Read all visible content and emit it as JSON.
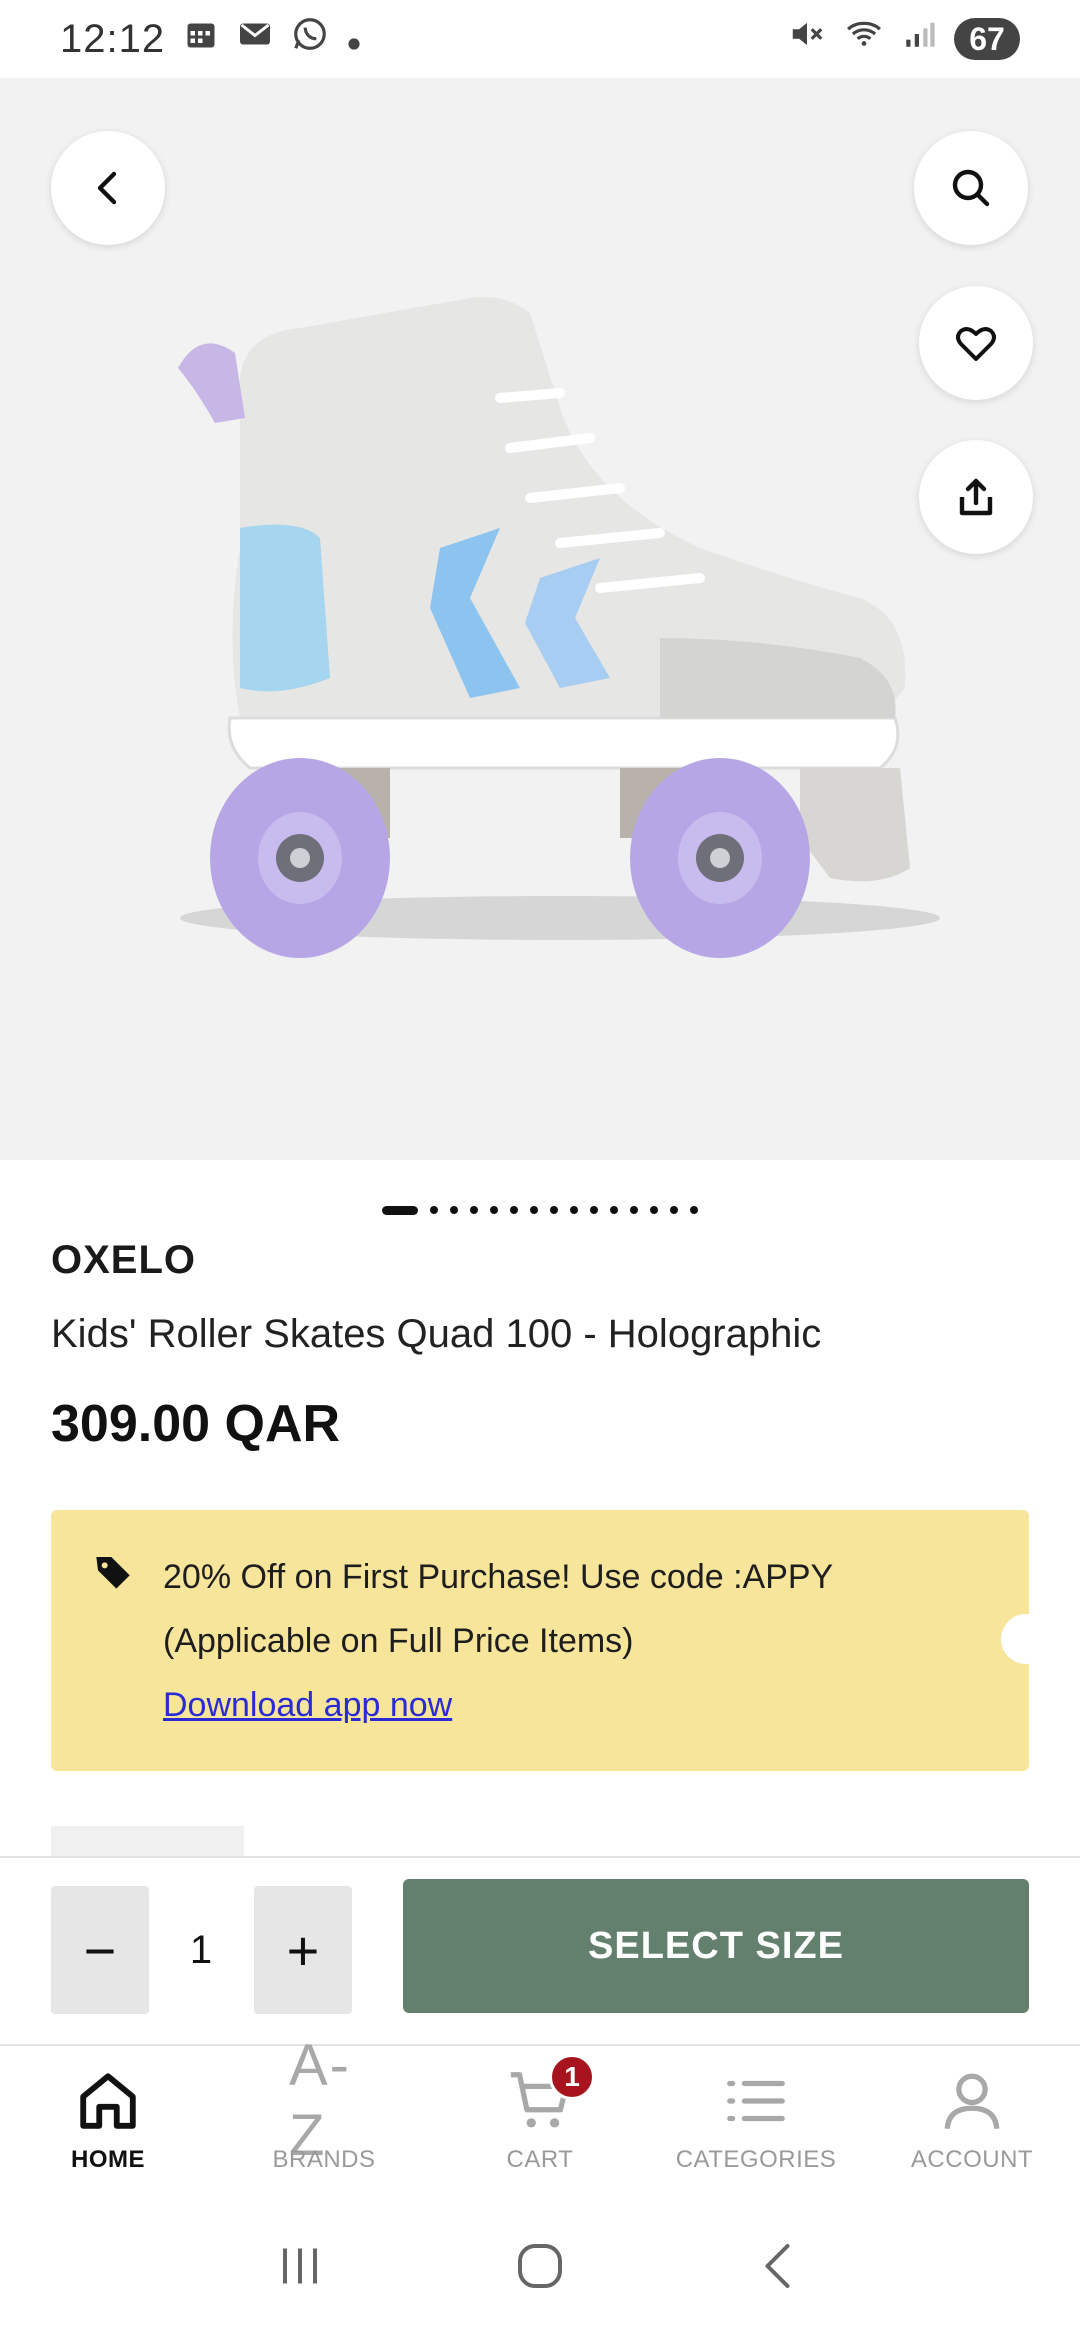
{
  "status_bar": {
    "time": "12:12",
    "battery": "67",
    "left_icons": [
      "calendar-icon",
      "mail-icon",
      "whatsapp-icon",
      "dot-icon"
    ],
    "right_icons": [
      "mute-icon",
      "wifi-icon",
      "signal-icon"
    ]
  },
  "product": {
    "brand": "OXELO",
    "title": "Kids' Roller Skates Quad 100 - Holographic",
    "price": "309.00 QAR",
    "image_count": 15,
    "active_image": 0
  },
  "promo": {
    "line1": "20% Off on First Purchase! Use code :APPY",
    "line2": "(Applicable on Full Price Items)",
    "link": "Download app now",
    "bg_color": "#f6e59b"
  },
  "purchase": {
    "quantity": "1",
    "minus": "−",
    "plus": "+",
    "select_size": "SELECT SIZE",
    "button_color": "#63806e"
  },
  "nav": {
    "home": "HOME",
    "brands": "BRANDS",
    "brands_icon_text": "A-Z",
    "cart": "CART",
    "cart_badge": "1",
    "categories": "CATEGORIES",
    "account": "ACCOUNT"
  }
}
